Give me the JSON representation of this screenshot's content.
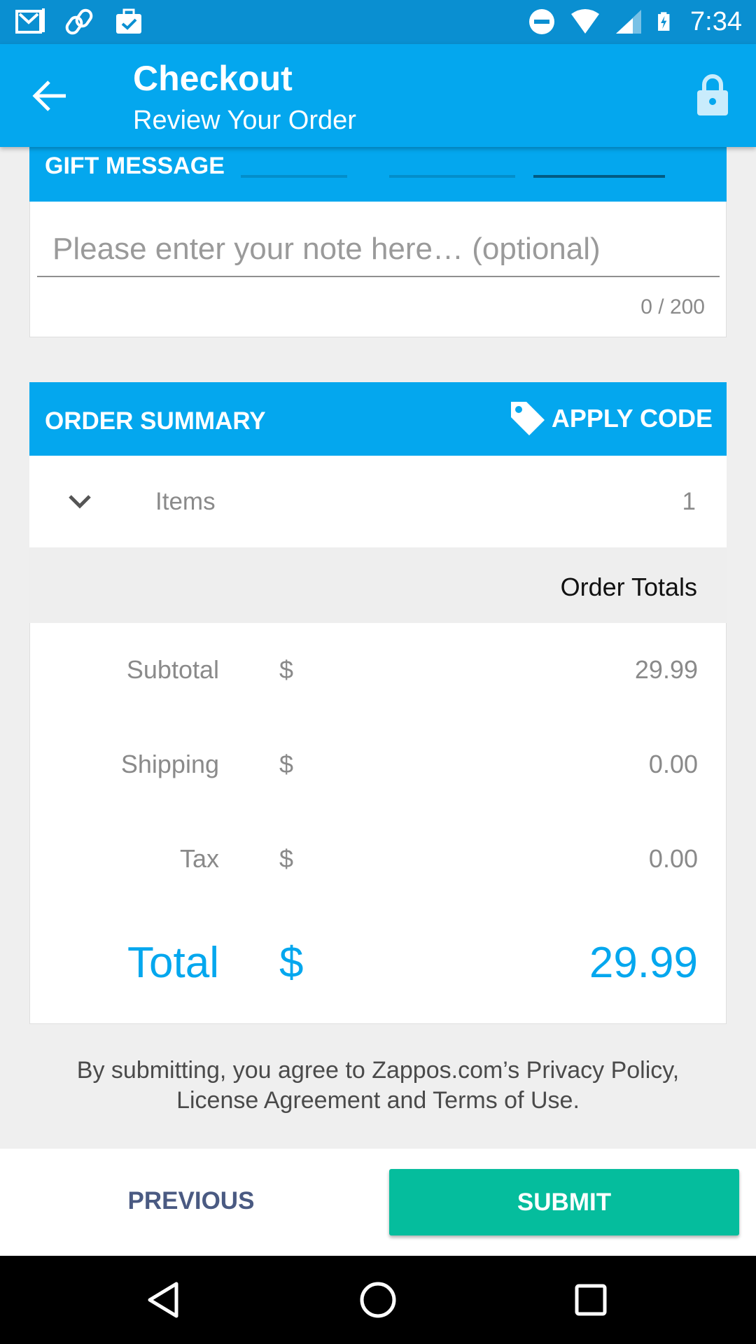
{
  "status_bar": {
    "time": "7:34",
    "left_icons": [
      "gmail-icon",
      "link-icon",
      "briefcase-check-icon"
    ],
    "right_icons": [
      "do-not-disturb-icon",
      "wifi-icon",
      "signal-icon",
      "battery-charging-icon"
    ]
  },
  "app_bar": {
    "title": "Checkout",
    "subtitle": "Review Your Order",
    "back_icon": "arrow-back-icon",
    "lock_icon": "lock-icon"
  },
  "gift_message": {
    "header": "GIFT MESSAGE",
    "placeholder": "Please enter your note here… (optional)",
    "value": "",
    "char_count": "0 / 200"
  },
  "order_summary": {
    "title": "ORDER SUMMARY",
    "apply_code_label": "APPLY CODE",
    "apply_code_icon": "tag-icon",
    "items_label": "Items",
    "items_count": "1",
    "totals_header": "Order Totals",
    "rows": [
      {
        "label": "Subtotal",
        "currency": "$",
        "value": "29.99"
      },
      {
        "label": "Shipping",
        "currency": "$",
        "value": "0.00"
      },
      {
        "label": "Tax",
        "currency": "$",
        "value": "0.00"
      }
    ],
    "total": {
      "label": "Total",
      "currency": "$",
      "value": "29.99"
    }
  },
  "legal": {
    "line1": "By submitting, you agree to Zappos.com’s Privacy Policy,",
    "line2": "License Agreement and Terms of Use."
  },
  "actions": {
    "previous_label": "PREVIOUS",
    "submit_label": "SUBMIT"
  },
  "nav_bar": {
    "icons": [
      "back-triangle-icon",
      "home-circle-icon",
      "recents-square-icon"
    ]
  },
  "colors": {
    "status_bar": "#0a8fd1",
    "primary": "#04a7ee",
    "submit": "#05bd9d",
    "previous_text": "#4a5a82"
  }
}
